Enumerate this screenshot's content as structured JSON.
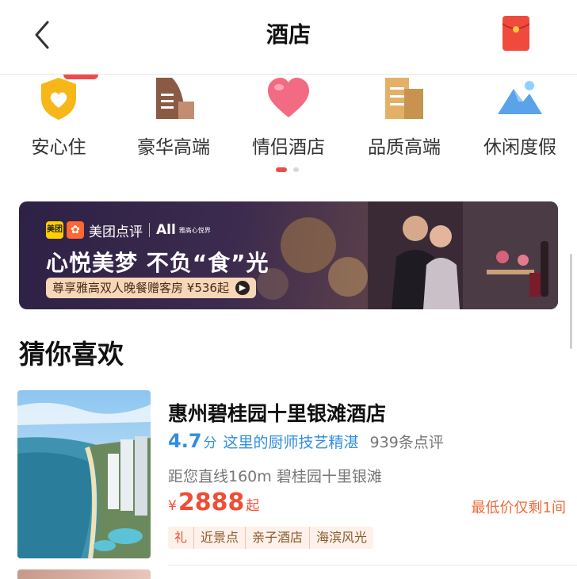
{
  "header": {
    "title": "酒店"
  },
  "categories": [
    {
      "label": "安心住",
      "icon": "shield-heart-icon"
    },
    {
      "label": "豪华高端",
      "icon": "luxury-building-icon"
    },
    {
      "label": "情侣酒店",
      "icon": "heart-icon"
    },
    {
      "label": "品质高端",
      "icon": "quality-building-icon"
    },
    {
      "label": "休闲度假",
      "icon": "mountain-icon"
    }
  ],
  "banner": {
    "brand_mt": "美团",
    "brand_dp": "美团点评",
    "brand_all": "All",
    "brand_all_sub": "雅高心悦界",
    "headline": "心悦美梦 不负“食”光",
    "cta": "尊享雅高双人晚餐赠客房 ¥536起"
  },
  "section": {
    "title": "猜你喜欢"
  },
  "hotel": {
    "name": "惠州碧桂园十里银滩酒店",
    "score": "4.7",
    "score_unit": "分",
    "highlight": "这里的厨师技艺精湛",
    "reviews": "939条点评",
    "distance": "距您直线160m 碧桂园十里银滩",
    "currency": "¥",
    "price": "2888",
    "price_suffix": "起",
    "low_price_note": "最低价仅剩1间",
    "tags": [
      "礼",
      "近景点",
      "亲子酒店",
      "海滨风光"
    ]
  },
  "colors": {
    "accent_red": "#ef4d35",
    "rating_blue": "#2f8ee0",
    "dot_active": "#ef4d4d"
  }
}
